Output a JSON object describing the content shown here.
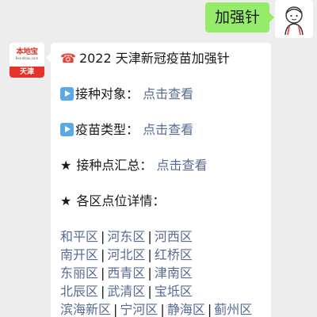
{
  "outgoing": {
    "text": "加强针"
  },
  "sender": {
    "logo_word": "本地宝",
    "logo_url": "Bendibao.com",
    "logo_city": "天津"
  },
  "message": {
    "title_icon": "☎",
    "title": "2022 天津新冠疫苗加强针",
    "target_label": "接种对象：",
    "target_link": "点击查看",
    "type_label": "疫苗类型：",
    "type_link": "点击查看",
    "sites_star": "★",
    "sites_label": "接种点汇总：",
    "sites_link": "点击查看",
    "districts_star": "★",
    "districts_label": "各区点位详情：",
    "district_rows": [
      [
        "和平区",
        "河东区",
        "河西区"
      ],
      [
        "南开区",
        "河北区",
        "红桥区"
      ],
      [
        "东丽区",
        "西青区",
        "津南区"
      ],
      [
        "北辰区",
        "武清区",
        "宝坻区"
      ],
      [
        "滨海新区",
        "宁河区",
        "静海区",
        "蓟州区"
      ]
    ],
    "separator": "|"
  },
  "colors": {
    "outgoing_bubble": "#95ec69",
    "link": "#576b95",
    "background": "#ededed",
    "play_icon": "#5aa9e8"
  }
}
